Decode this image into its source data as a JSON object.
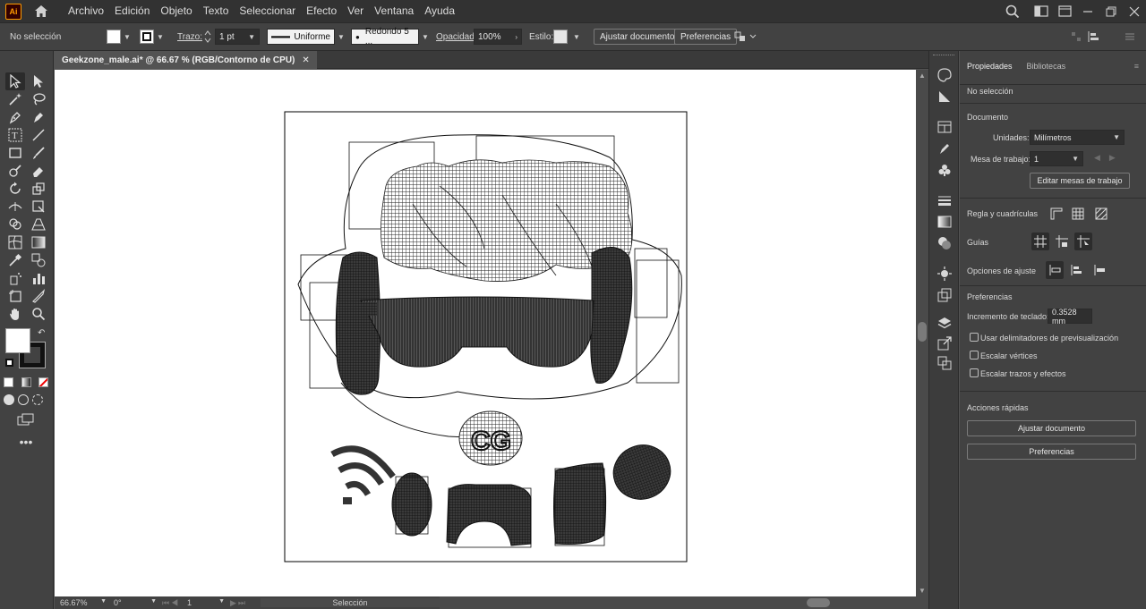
{
  "app": {
    "logo_text": "Ai"
  },
  "menu": [
    "Archivo",
    "Edición",
    "Objeto",
    "Texto",
    "Seleccionar",
    "Efecto",
    "Ver",
    "Ventana",
    "Ayuda"
  ],
  "control": {
    "selection_status": "No selección",
    "stroke_label": "Trazo:",
    "stroke_weight": "1 pt",
    "stroke_profile": "Uniforme",
    "brush": "Redondo 5 ...",
    "opacity_label": "Opacidad:",
    "opacity_value": "100%",
    "style_label": "Estilo:",
    "fit_document_button": "Ajustar documento",
    "preferences_button": "Preferencias"
  },
  "document": {
    "tab_title": "Geekzone_male.ai* @ 66.67 % (RGB/Contorno de CPU)",
    "close_glyph": "✕"
  },
  "status": {
    "zoom": "66.67%",
    "rotation": "0°",
    "artboard": "1",
    "tool": "Selección"
  },
  "panel": {
    "tabs": [
      "Propiedades",
      "Bibliotecas"
    ],
    "no_selection": "No selección",
    "document_section": "Documento",
    "units_label": "Unidades:",
    "units_value": "Milímetros",
    "artboard_label": "Mesa de trabajo:",
    "artboard_value": "1",
    "edit_artboards_button": "Editar mesas de trabajo",
    "rulers_label": "Regla y cuadrículas",
    "guides_label": "Guías",
    "snap_label": "Opciones de ajuste",
    "preferences_section": "Preferencias",
    "keyboard_increment_label": "Incremento de teclado:",
    "keyboard_increment_value": "0.3528 mm",
    "checkboxes": [
      "Usar delimitadores de previsualización",
      "Escalar vértices",
      "Escalar trazos y efectos"
    ],
    "quick_actions_label": "Acciones rápidas",
    "quick_fit_button": "Ajustar documento",
    "quick_prefs_button": "Preferencias"
  },
  "colors": {
    "app_bg": "#535353",
    "menubar": "#323232",
    "panel": "#424242",
    "canvas": "#ffffff",
    "accent_logo": "#ff9a00"
  }
}
